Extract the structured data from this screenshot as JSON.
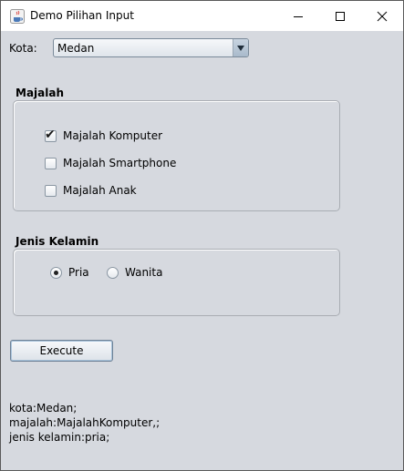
{
  "window": {
    "title": "Demo Pilihan Input",
    "icons": {
      "app": "java-cup-icon",
      "minimize": "minimize-icon",
      "maximize": "maximize-icon",
      "close": "close-icon"
    }
  },
  "kota": {
    "label": "Kota:",
    "selected": "Medan"
  },
  "majalah": {
    "title": "Majalah",
    "items": [
      {
        "label": "Majalah Komputer",
        "checked": true
      },
      {
        "label": "Majalah Smartphone",
        "checked": false
      },
      {
        "label": "Majalah Anak",
        "checked": false
      }
    ]
  },
  "jenis_kelamin": {
    "title": "Jenis Kelamin",
    "options": [
      {
        "label": "Pria",
        "selected": true
      },
      {
        "label": "Wanita",
        "selected": false
      }
    ]
  },
  "execute_label": "Execute",
  "output": [
    "kota:Medan;",
    "majalah:MajalahKomputer,;",
    "jenis kelamin:pria;"
  ],
  "colors": {
    "window_bg": "#d6d9df",
    "titlebar_bg": "#ffffff"
  }
}
